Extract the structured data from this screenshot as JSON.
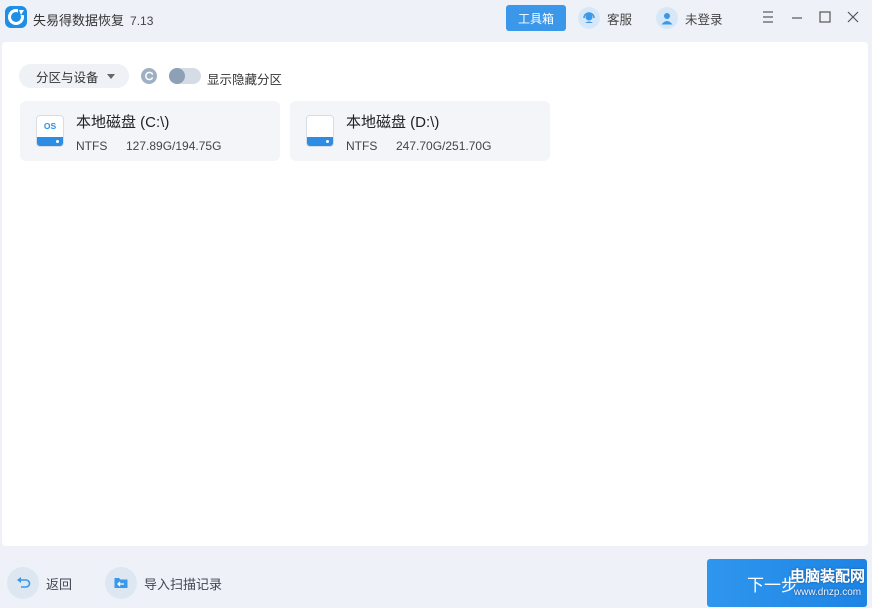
{
  "app": {
    "title": "失易得数据恢复",
    "version": "7.13"
  },
  "header": {
    "toolbox_label": "工具箱",
    "service_label": "客服",
    "login_label": "未登录"
  },
  "toolbar": {
    "partition_dropdown": "分区与设备",
    "show_hidden_label": "显示隐藏分区",
    "show_hidden_enabled": false
  },
  "drives": [
    {
      "name": "本地磁盘 (C:\\)",
      "fs": "NTFS",
      "size": "127.89G/194.75G",
      "icon_text": "OS",
      "icon": "system-drive-icon"
    },
    {
      "name": "本地磁盘 (D:\\)",
      "fs": "NTFS",
      "size": "247.70G/251.70G",
      "icon_text": "",
      "icon": "disk-drive-icon"
    }
  ],
  "footer": {
    "back_label": "返回",
    "import_label": "导入扫描记录",
    "next_label": "下一步",
    "watermark_name": "电脑装配网",
    "watermark_url": "www.dnzp.com"
  },
  "colors": {
    "accent": "#2f96ee",
    "background": "#eef2f8",
    "card": "#f3f5f8"
  }
}
